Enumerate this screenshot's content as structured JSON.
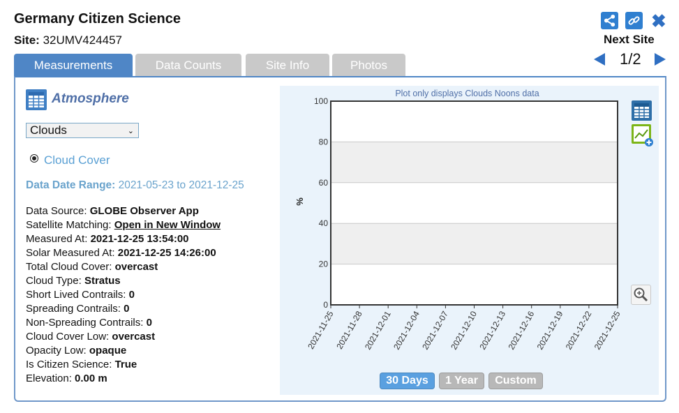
{
  "header": {
    "title": "Germany Citizen Science",
    "site_label": "Site:",
    "site_value": "32UMV424457",
    "next_site_label": "Next Site",
    "pager": "1/2"
  },
  "tabs": [
    {
      "label": "Measurements",
      "active": true
    },
    {
      "label": "Data Counts",
      "active": false
    },
    {
      "label": "Site Info",
      "active": false
    },
    {
      "label": "Photos",
      "active": false
    }
  ],
  "left": {
    "section_title": "Atmosphere",
    "protocol_select": "Clouds",
    "radio_label": "Cloud Cover",
    "range_label": "Data Date Range:",
    "range_value": "2021-05-23 to 2021-12-25",
    "details": [
      {
        "label": "Data Source: ",
        "value": "GLOBE Observer App"
      },
      {
        "label": "Satellite Matching: ",
        "value": "Open in New Window",
        "link": true
      },
      {
        "label": "Measured At: ",
        "value": "2021-12-25 13:54:00"
      },
      {
        "label": "Solar Measured At: ",
        "value": "2021-12-25 14:26:00"
      },
      {
        "label": "Total Cloud Cover: ",
        "value": "overcast"
      },
      {
        "label": "Cloud Type: ",
        "value": "Stratus"
      },
      {
        "label": "Short Lived Contrails: ",
        "value": "0"
      },
      {
        "label": "Spreading Contrails: ",
        "value": "0"
      },
      {
        "label": "Non-Spreading Contrails: ",
        "value": "0"
      },
      {
        "label": "Cloud Cover Low: ",
        "value": "overcast"
      },
      {
        "label": "Opacity Low: ",
        "value": "opaque"
      },
      {
        "label": "Is Citizen Science: ",
        "value": "True"
      },
      {
        "label": "Elevation: ",
        "value": "0.00 m"
      }
    ]
  },
  "range_buttons": [
    "30 Days",
    "1 Year",
    "Custom"
  ],
  "colors": {
    "accent": "#4f86c6",
    "tab_inactive": "#c9c9c9",
    "chart_bg": "#eaf3fb",
    "link_blue": "#5aa0d4"
  },
  "icons": [
    "share-icon",
    "link-icon",
    "close-icon",
    "table-icon",
    "add-chart-icon",
    "zoom-icon"
  ],
  "chart_data": {
    "type": "line",
    "title": "Plot only displays Clouds Noons data",
    "xlabel": "",
    "ylabel": "%",
    "ylim": [
      0,
      100
    ],
    "yticks": [
      "0",
      "20",
      "40",
      "60",
      "80",
      "100"
    ],
    "xticks": [
      "2021-11-25",
      "2021-11-28",
      "2021-12-01",
      "2021-12-04",
      "2021-12-07",
      "2021-12-10",
      "2021-12-13",
      "2021-12-16",
      "2021-12-19",
      "2021-12-22",
      "2021-12-25"
    ],
    "series": [],
    "grid": true
  }
}
